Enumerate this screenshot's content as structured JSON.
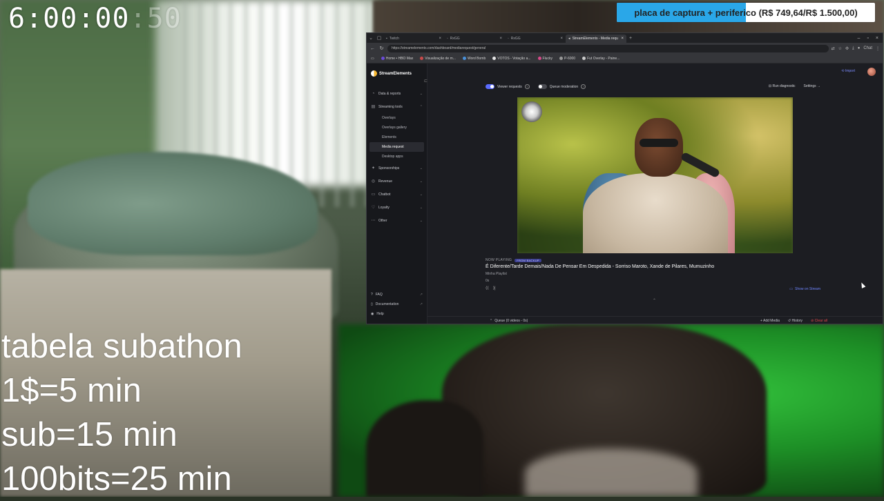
{
  "timer": {
    "main": "6:00:00",
    "ms": ":50"
  },
  "goal": {
    "text": "placa de captura + periferico (R$ 749,64/R$ 1.500,00)",
    "progress": 0.4998
  },
  "subathon": {
    "lines": [
      "tabela subathon",
      "1$=5 min",
      "sub=15 min",
      "100bits=25 min"
    ]
  },
  "browser": {
    "tabs": [
      {
        "label": "Twitch",
        "active": false
      },
      {
        "label": "RxGG",
        "active": false
      },
      {
        "label": "RxGG",
        "active": false
      },
      {
        "label": "StreamElements - Media requ",
        "active": true
      }
    ],
    "url": "https://streamelements.com/dashboard/mediarequest/general",
    "profile": "Chat",
    "bookmarks": [
      {
        "label": "Home • HBO Max",
        "color": "#6b4bd8"
      },
      {
        "label": "Visualização de m...",
        "color": "#c94a4a"
      },
      {
        "label": "Word Bomb",
        "color": "#4a90d8"
      },
      {
        "label": "VOTOS - Votação a...",
        "color": "#e6e6e6"
      },
      {
        "label": "Flucky",
        "color": "#d84a8a"
      },
      {
        "label": "P-6000",
        "color": "#999999"
      },
      {
        "label": "Fut Overlay - Paine...",
        "color": "#cccccc"
      }
    ]
  },
  "sidebar": {
    "brand": "StreamElements",
    "items": [
      {
        "label": "Data & reports",
        "icon": "chart-icon",
        "glyph": "◔",
        "chevron": "⌄"
      },
      {
        "label": "Streaming tools",
        "icon": "tools-icon",
        "glyph": "▤",
        "chevron": "⌃"
      }
    ],
    "sub_items": [
      {
        "label": "Overlays",
        "active": false
      },
      {
        "label": "Overlays gallery",
        "active": false
      },
      {
        "label": "Elements",
        "active": false
      },
      {
        "label": "Media request",
        "active": true
      },
      {
        "label": "Desktop apps",
        "active": false
      }
    ],
    "items2": [
      {
        "label": "Sponsorships",
        "icon": "star-icon",
        "glyph": "✦",
        "chevron": "⌄"
      },
      {
        "label": "Revenue",
        "icon": "coin-icon",
        "glyph": "◎",
        "chevron": "⌄"
      },
      {
        "label": "Chatbot",
        "icon": "chat-icon",
        "glyph": "▭",
        "chevron": "⌄"
      },
      {
        "label": "Loyalty",
        "icon": "heart-icon",
        "glyph": "♡",
        "chevron": "⌄"
      },
      {
        "label": "Other",
        "icon": "more-icon",
        "glyph": "⋯",
        "chevron": "⌄"
      }
    ],
    "bottom": [
      {
        "label": "FAQ",
        "icon": "faq-icon",
        "glyph": "?"
      },
      {
        "label": "Documentation",
        "icon": "doc-icon",
        "glyph": "▯"
      },
      {
        "label": "Help",
        "icon": "help-icon",
        "glyph": "◉"
      }
    ]
  },
  "main": {
    "import_label": "Import",
    "toggles": [
      {
        "label": "Viewer requests",
        "on": true
      },
      {
        "label": "Queue moderation",
        "on": false
      }
    ],
    "run_diagnostic": "Run diagnostic",
    "settings": "Settings",
    "now_playing_label": "NOW PLAYING",
    "badge": "FROM BACKUP",
    "title": "É Diferente/Tarde Demais/Nada De Pensar Em Despedida - Sorriso Maroto, Xande de Pilares, Mumuzinho",
    "playlist": "Minha Playlist",
    "time": "0s",
    "show_on_stream": "Show on Stream",
    "queue_label": "Queue (0 videos - 0s)",
    "add_media": "Add Media",
    "history": "History",
    "clear": "Clear all"
  }
}
